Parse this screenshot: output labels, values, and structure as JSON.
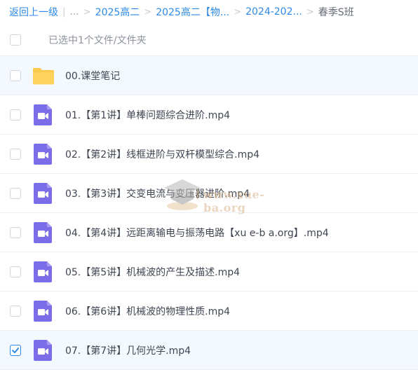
{
  "breadcrumb": {
    "back": "返回上一级",
    "ellipsis": "...",
    "crumbs": [
      "2025高二",
      "2025高二【物...",
      "2024-202..."
    ],
    "current": "春季S班"
  },
  "selection": {
    "text": "已选中1个文件/文件夹"
  },
  "files": [
    {
      "name": "00.课堂笔记",
      "type": "folder",
      "checked": false
    },
    {
      "name": "01.【第1讲】单棒问题综合进阶.mp4",
      "type": "video",
      "checked": false
    },
    {
      "name": "02.【第2讲】线框进阶与双杆模型综合.mp4",
      "type": "video",
      "checked": false
    },
    {
      "name": "03.【第3讲】交变电流与变压器进阶.mp4",
      "type": "video",
      "checked": false
    },
    {
      "name": "04.【第4讲】远距离输电与振荡电路【xu e-b a.org】.mp4",
      "type": "video",
      "checked": false
    },
    {
      "name": "05.【第5讲】机械波的产生及描述.mp4",
      "type": "video",
      "checked": false
    },
    {
      "name": "06.【第6讲】机械波的物理性质.mp4",
      "type": "video",
      "checked": false
    },
    {
      "name": "07.【第7讲】几何光学.mp4",
      "type": "video",
      "checked": true
    }
  ],
  "watermark": {
    "text": "www.xue-ba.org"
  },
  "colors": {
    "accent": "#2c8ae8",
    "folder": "#fbc94b",
    "video": "#7b6ee8"
  }
}
